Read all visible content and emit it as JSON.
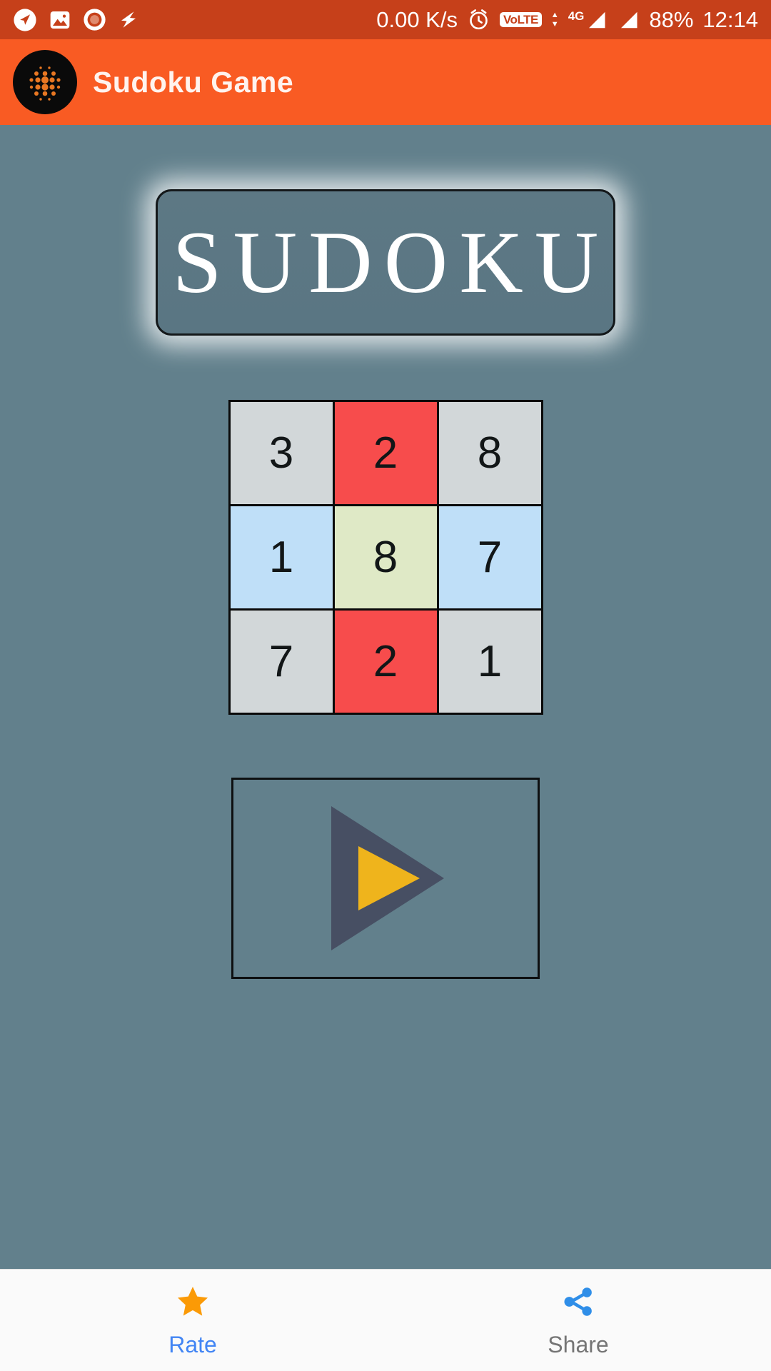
{
  "statusbar": {
    "icons_left": [
      "navigation-icon",
      "gallery-icon",
      "record-icon",
      "flash-icon"
    ],
    "network_speed": "0.00 K/s",
    "alarm_icon": "alarm-icon",
    "volte_label": "VoLTE",
    "network_type": "4G",
    "battery": "88%",
    "time": "12:14"
  },
  "appbar": {
    "logo": "sudoku-dots-logo",
    "title": "Sudoku Game"
  },
  "main": {
    "title": "SUDOKU",
    "play_button": "play-button",
    "grid": {
      "rows": [
        [
          {
            "value": "3",
            "color": "#D2D7D9"
          },
          {
            "value": "2",
            "color": "#F74C4C"
          },
          {
            "value": "8",
            "color": "#D2D7D9"
          }
        ],
        [
          {
            "value": "1",
            "color": "#BFDFF8"
          },
          {
            "value": "8",
            "color": "#DFE9C6"
          },
          {
            "value": "7",
            "color": "#BFDFF8"
          }
        ],
        [
          {
            "value": "7",
            "color": "#D2D7D9"
          },
          {
            "value": "2",
            "color": "#F74C4C"
          },
          {
            "value": "1",
            "color": "#D2D7D9"
          }
        ]
      ]
    }
  },
  "bottomnav": {
    "items": [
      {
        "label": "Rate",
        "icon": "star-icon",
        "state": "active"
      },
      {
        "label": "Share",
        "icon": "share-icon",
        "state": "inactive"
      }
    ]
  },
  "colors": {
    "status_bar": "#C6401A",
    "app_bar": "#F95B23",
    "background": "#62808C",
    "cell_gray": "#D2D7D9",
    "cell_red": "#F74C4C",
    "cell_blue": "#BFDFF8",
    "cell_green": "#DFE9C6",
    "play_outer": "#474F63",
    "play_inner": "#EFB41C",
    "star": "#FB9A06",
    "share": "#2F8EE8",
    "rate_text": "#4285F4",
    "share_text": "#757575"
  }
}
